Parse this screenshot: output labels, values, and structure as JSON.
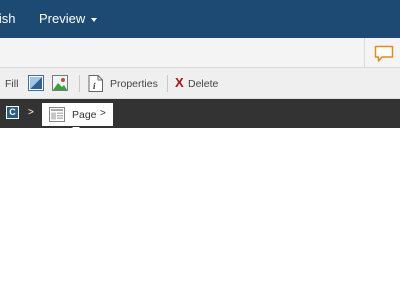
{
  "header": {
    "publish_label": "lish",
    "preview_label": "Preview"
  },
  "toolbar": {
    "fill_label": "Fill",
    "properties_label": "Properties",
    "delete_label": "Delete",
    "delete_glyph": "X"
  },
  "breadcrumb": {
    "root_icon_letter": "C",
    "separator": ">",
    "page_label": "Page",
    "page_separator": ">"
  },
  "colors": {
    "header_bg": "#1c4a72",
    "breadcrumb_bg": "#333333",
    "comment_accent": "#e8871e",
    "delete_red": "#b01010"
  }
}
